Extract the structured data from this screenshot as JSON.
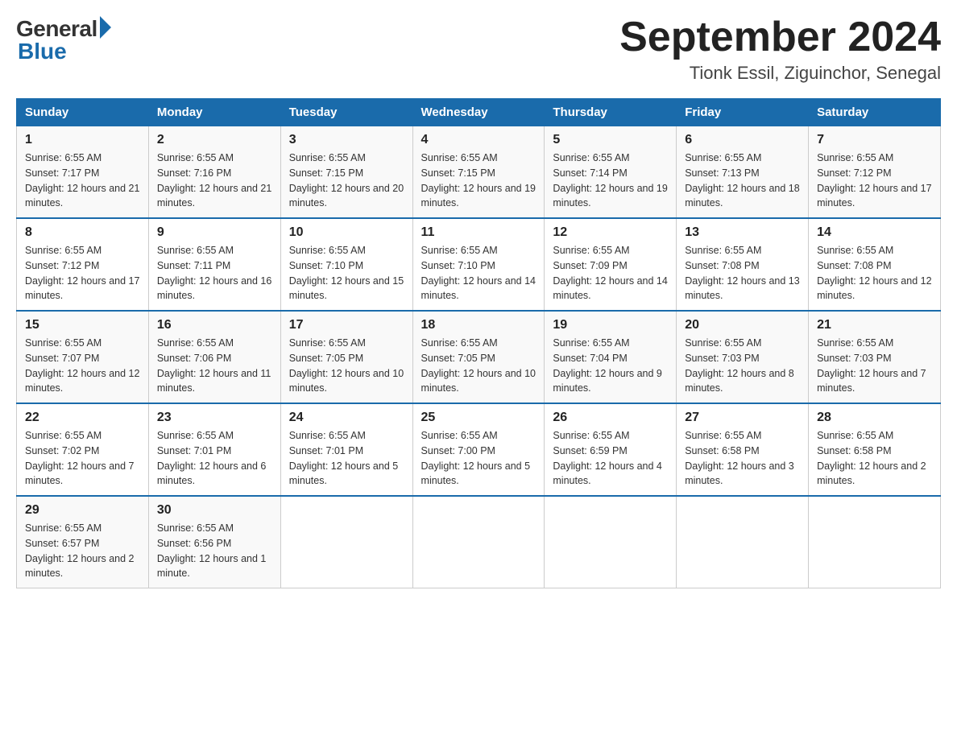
{
  "header": {
    "logo_general": "General",
    "logo_blue": "Blue",
    "month_title": "September 2024",
    "location": "Tionk Essil, Ziguinchor, Senegal"
  },
  "calendar": {
    "days_of_week": [
      "Sunday",
      "Monday",
      "Tuesday",
      "Wednesday",
      "Thursday",
      "Friday",
      "Saturday"
    ],
    "weeks": [
      [
        {
          "day": "1",
          "sunrise": "Sunrise: 6:55 AM",
          "sunset": "Sunset: 7:17 PM",
          "daylight": "Daylight: 12 hours and 21 minutes."
        },
        {
          "day": "2",
          "sunrise": "Sunrise: 6:55 AM",
          "sunset": "Sunset: 7:16 PM",
          "daylight": "Daylight: 12 hours and 21 minutes."
        },
        {
          "day": "3",
          "sunrise": "Sunrise: 6:55 AM",
          "sunset": "Sunset: 7:15 PM",
          "daylight": "Daylight: 12 hours and 20 minutes."
        },
        {
          "day": "4",
          "sunrise": "Sunrise: 6:55 AM",
          "sunset": "Sunset: 7:15 PM",
          "daylight": "Daylight: 12 hours and 19 minutes."
        },
        {
          "day": "5",
          "sunrise": "Sunrise: 6:55 AM",
          "sunset": "Sunset: 7:14 PM",
          "daylight": "Daylight: 12 hours and 19 minutes."
        },
        {
          "day": "6",
          "sunrise": "Sunrise: 6:55 AM",
          "sunset": "Sunset: 7:13 PM",
          "daylight": "Daylight: 12 hours and 18 minutes."
        },
        {
          "day": "7",
          "sunrise": "Sunrise: 6:55 AM",
          "sunset": "Sunset: 7:12 PM",
          "daylight": "Daylight: 12 hours and 17 minutes."
        }
      ],
      [
        {
          "day": "8",
          "sunrise": "Sunrise: 6:55 AM",
          "sunset": "Sunset: 7:12 PM",
          "daylight": "Daylight: 12 hours and 17 minutes."
        },
        {
          "day": "9",
          "sunrise": "Sunrise: 6:55 AM",
          "sunset": "Sunset: 7:11 PM",
          "daylight": "Daylight: 12 hours and 16 minutes."
        },
        {
          "day": "10",
          "sunrise": "Sunrise: 6:55 AM",
          "sunset": "Sunset: 7:10 PM",
          "daylight": "Daylight: 12 hours and 15 minutes."
        },
        {
          "day": "11",
          "sunrise": "Sunrise: 6:55 AM",
          "sunset": "Sunset: 7:10 PM",
          "daylight": "Daylight: 12 hours and 14 minutes."
        },
        {
          "day": "12",
          "sunrise": "Sunrise: 6:55 AM",
          "sunset": "Sunset: 7:09 PM",
          "daylight": "Daylight: 12 hours and 14 minutes."
        },
        {
          "day": "13",
          "sunrise": "Sunrise: 6:55 AM",
          "sunset": "Sunset: 7:08 PM",
          "daylight": "Daylight: 12 hours and 13 minutes."
        },
        {
          "day": "14",
          "sunrise": "Sunrise: 6:55 AM",
          "sunset": "Sunset: 7:08 PM",
          "daylight": "Daylight: 12 hours and 12 minutes."
        }
      ],
      [
        {
          "day": "15",
          "sunrise": "Sunrise: 6:55 AM",
          "sunset": "Sunset: 7:07 PM",
          "daylight": "Daylight: 12 hours and 12 minutes."
        },
        {
          "day": "16",
          "sunrise": "Sunrise: 6:55 AM",
          "sunset": "Sunset: 7:06 PM",
          "daylight": "Daylight: 12 hours and 11 minutes."
        },
        {
          "day": "17",
          "sunrise": "Sunrise: 6:55 AM",
          "sunset": "Sunset: 7:05 PM",
          "daylight": "Daylight: 12 hours and 10 minutes."
        },
        {
          "day": "18",
          "sunrise": "Sunrise: 6:55 AM",
          "sunset": "Sunset: 7:05 PM",
          "daylight": "Daylight: 12 hours and 10 minutes."
        },
        {
          "day": "19",
          "sunrise": "Sunrise: 6:55 AM",
          "sunset": "Sunset: 7:04 PM",
          "daylight": "Daylight: 12 hours and 9 minutes."
        },
        {
          "day": "20",
          "sunrise": "Sunrise: 6:55 AM",
          "sunset": "Sunset: 7:03 PM",
          "daylight": "Daylight: 12 hours and 8 minutes."
        },
        {
          "day": "21",
          "sunrise": "Sunrise: 6:55 AM",
          "sunset": "Sunset: 7:03 PM",
          "daylight": "Daylight: 12 hours and 7 minutes."
        }
      ],
      [
        {
          "day": "22",
          "sunrise": "Sunrise: 6:55 AM",
          "sunset": "Sunset: 7:02 PM",
          "daylight": "Daylight: 12 hours and 7 minutes."
        },
        {
          "day": "23",
          "sunrise": "Sunrise: 6:55 AM",
          "sunset": "Sunset: 7:01 PM",
          "daylight": "Daylight: 12 hours and 6 minutes."
        },
        {
          "day": "24",
          "sunrise": "Sunrise: 6:55 AM",
          "sunset": "Sunset: 7:01 PM",
          "daylight": "Daylight: 12 hours and 5 minutes."
        },
        {
          "day": "25",
          "sunrise": "Sunrise: 6:55 AM",
          "sunset": "Sunset: 7:00 PM",
          "daylight": "Daylight: 12 hours and 5 minutes."
        },
        {
          "day": "26",
          "sunrise": "Sunrise: 6:55 AM",
          "sunset": "Sunset: 6:59 PM",
          "daylight": "Daylight: 12 hours and 4 minutes."
        },
        {
          "day": "27",
          "sunrise": "Sunrise: 6:55 AM",
          "sunset": "Sunset: 6:58 PM",
          "daylight": "Daylight: 12 hours and 3 minutes."
        },
        {
          "day": "28",
          "sunrise": "Sunrise: 6:55 AM",
          "sunset": "Sunset: 6:58 PM",
          "daylight": "Daylight: 12 hours and 2 minutes."
        }
      ],
      [
        {
          "day": "29",
          "sunrise": "Sunrise: 6:55 AM",
          "sunset": "Sunset: 6:57 PM",
          "daylight": "Daylight: 12 hours and 2 minutes."
        },
        {
          "day": "30",
          "sunrise": "Sunrise: 6:55 AM",
          "sunset": "Sunset: 6:56 PM",
          "daylight": "Daylight: 12 hours and 1 minute."
        },
        {
          "day": "",
          "sunrise": "",
          "sunset": "",
          "daylight": ""
        },
        {
          "day": "",
          "sunrise": "",
          "sunset": "",
          "daylight": ""
        },
        {
          "day": "",
          "sunrise": "",
          "sunset": "",
          "daylight": ""
        },
        {
          "day": "",
          "sunrise": "",
          "sunset": "",
          "daylight": ""
        },
        {
          "day": "",
          "sunrise": "",
          "sunset": "",
          "daylight": ""
        }
      ]
    ]
  }
}
